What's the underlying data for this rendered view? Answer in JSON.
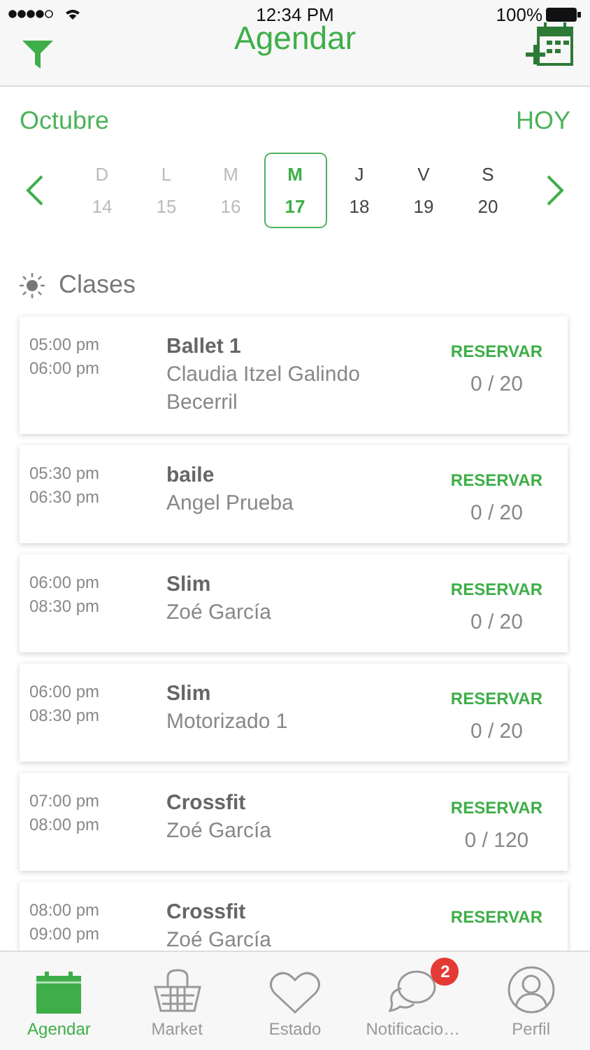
{
  "status_bar": {
    "time": "12:34 PM",
    "battery": "100%"
  },
  "header": {
    "title": "Agendar"
  },
  "calendar": {
    "month": "Octubre",
    "today_button": "HOY",
    "days": [
      {
        "letter": "D",
        "number": "14",
        "selected": false,
        "disabled": true
      },
      {
        "letter": "L",
        "number": "15",
        "selected": false,
        "disabled": true
      },
      {
        "letter": "M",
        "number": "16",
        "selected": false,
        "disabled": true
      },
      {
        "letter": "M",
        "number": "17",
        "selected": true,
        "disabled": false
      },
      {
        "letter": "J",
        "number": "18",
        "selected": false,
        "disabled": false
      },
      {
        "letter": "V",
        "number": "19",
        "selected": false,
        "disabled": false
      },
      {
        "letter": "S",
        "number": "20",
        "selected": false,
        "disabled": false
      }
    ]
  },
  "section": {
    "title": "Clases"
  },
  "classes": [
    {
      "start": "05:00 pm",
      "end": "06:00 pm",
      "name": "Ballet 1",
      "instructor": "Claudia Itzel Galindo Becerril",
      "action": "RESERVAR",
      "count": "0 / 20"
    },
    {
      "start": "05:30 pm",
      "end": "06:30 pm",
      "name": "baile",
      "instructor": "Angel Prueba",
      "action": "RESERVAR",
      "count": "0 / 20"
    },
    {
      "start": "06:00 pm",
      "end": "08:30 pm",
      "name": "Slim",
      "instructor": "Zoé García",
      "action": "RESERVAR",
      "count": "0 / 20"
    },
    {
      "start": "06:00 pm",
      "end": "08:30 pm",
      "name": "Slim",
      "instructor": "Motorizado 1",
      "action": "RESERVAR",
      "count": "0 / 20"
    },
    {
      "start": "07:00 pm",
      "end": "08:00 pm",
      "name": "Crossfit",
      "instructor": "Zoé García",
      "action": "RESERVAR",
      "count": "0 / 120"
    },
    {
      "start": "08:00 pm",
      "end": "09:00 pm",
      "name": "Crossfit",
      "instructor": "Zoé García",
      "action": "RESERVAR"
    }
  ],
  "tab_bar": [
    {
      "kind": "calendar",
      "label": "Agendar",
      "selected": true
    },
    {
      "kind": "basket",
      "label": "Market",
      "selected": false
    },
    {
      "kind": "heart",
      "label": "Estado",
      "selected": false
    },
    {
      "kind": "chat",
      "label": "Notificacio…",
      "selected": false,
      "badge": "2"
    },
    {
      "kind": "person",
      "label": "Perfil",
      "selected": false
    }
  ]
}
